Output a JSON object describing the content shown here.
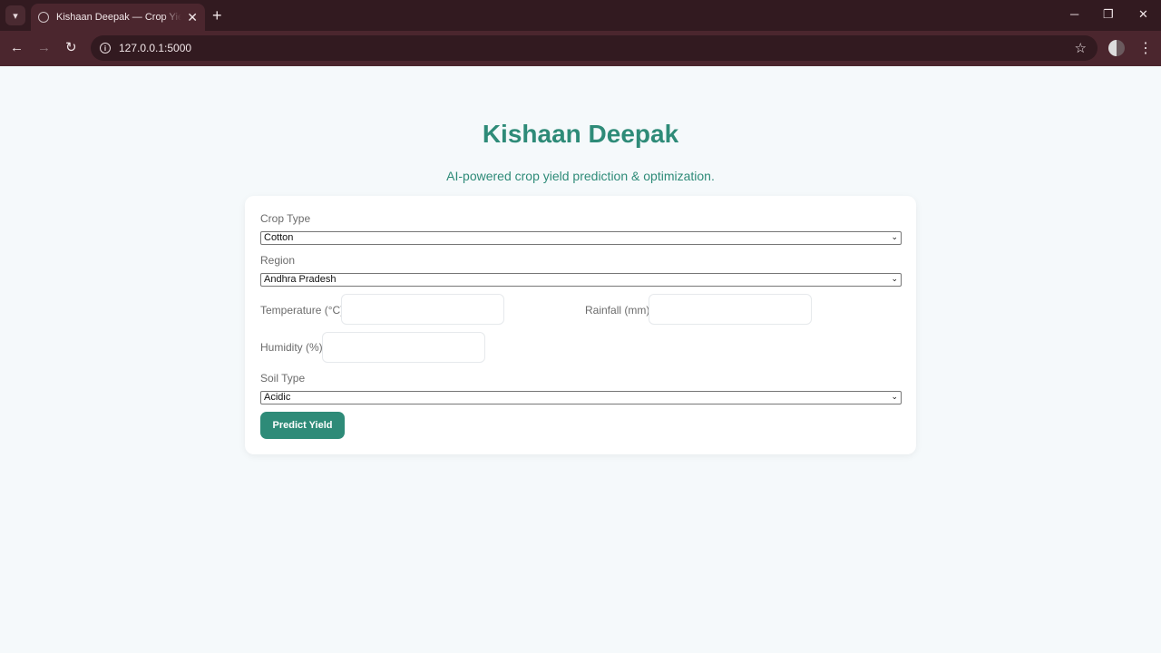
{
  "browser": {
    "tab_title": "Kishaan Deepak — Crop Yield Prediction",
    "url": "127.0.0.1:5000"
  },
  "page": {
    "title": "Kishaan Deepak",
    "subtitle": "AI-powered crop yield prediction & optimization."
  },
  "form": {
    "crop_type_label": "Crop Type",
    "crop_type_value": "Cotton",
    "region_label": "Region",
    "region_value": "Andhra Pradesh",
    "temperature_label": "Temperature (°C)",
    "rainfall_label": "Rainfall (mm)",
    "humidity_label": "Humidity (%)",
    "soil_type_label": "Soil Type",
    "soil_type_value": "Acidic",
    "submit_label": "Predict Yield"
  },
  "colors": {
    "accent": "#2e8b78",
    "chrome_dark": "#321a20",
    "chrome_mid": "#4b262e",
    "page_bg": "#f5f9fb"
  }
}
